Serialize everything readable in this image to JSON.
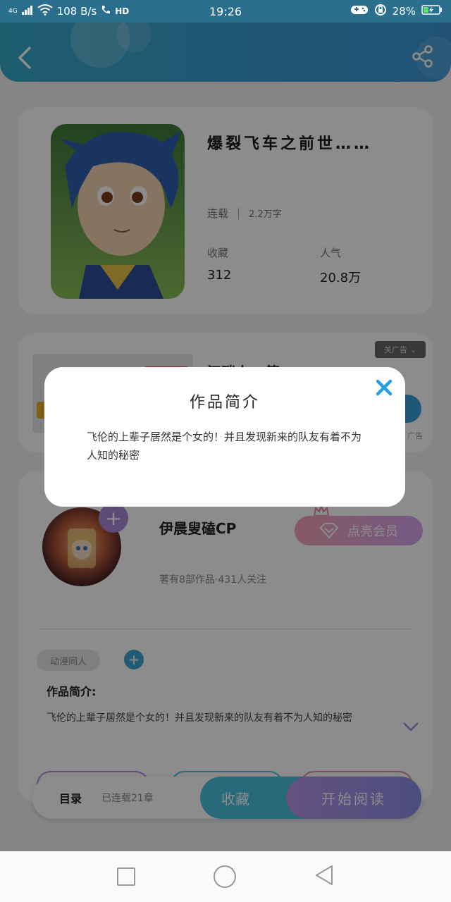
{
  "status_bar": {
    "network": "4G",
    "speed": "108 B/s",
    "hd": "HD",
    "time": "19:26",
    "battery": "28%"
  },
  "book": {
    "title": "爆裂飞车之前世……",
    "status": "连载",
    "word_count": "2.2万字",
    "favorites_label": "收藏",
    "favorites_value": "312",
    "popularity_label": "人气",
    "popularity_value": "20.8万"
  },
  "ad": {
    "close_label": "关广告",
    "title": "江畔人...第...",
    "tag": "广告"
  },
  "author": {
    "name": "伊晨叟磕CP",
    "vip_button": "点亮会员",
    "stats": "著有8部作品·431人关注",
    "tag": "动漫同人",
    "intro_heading": "作品简介:",
    "intro_text": "飞伦的上辈子居然是个女的！并且发现新来的队友有着不为人知的秘密"
  },
  "bottom_bar": {
    "toc_label": "目录",
    "chapters": "已连载21章",
    "favorite_button": "收藏",
    "read_button": "开始阅读"
  },
  "modal": {
    "title": "作品简介",
    "body": "飞伦的上辈子居然是个女的！并且发现新来的队友有着不为人知的秘密"
  },
  "colors": {
    "header": "#3aa0d3",
    "accent_blue": "#48c3e0",
    "accent_purple": "#a987d8",
    "close_icon": "#2b9fe0"
  }
}
